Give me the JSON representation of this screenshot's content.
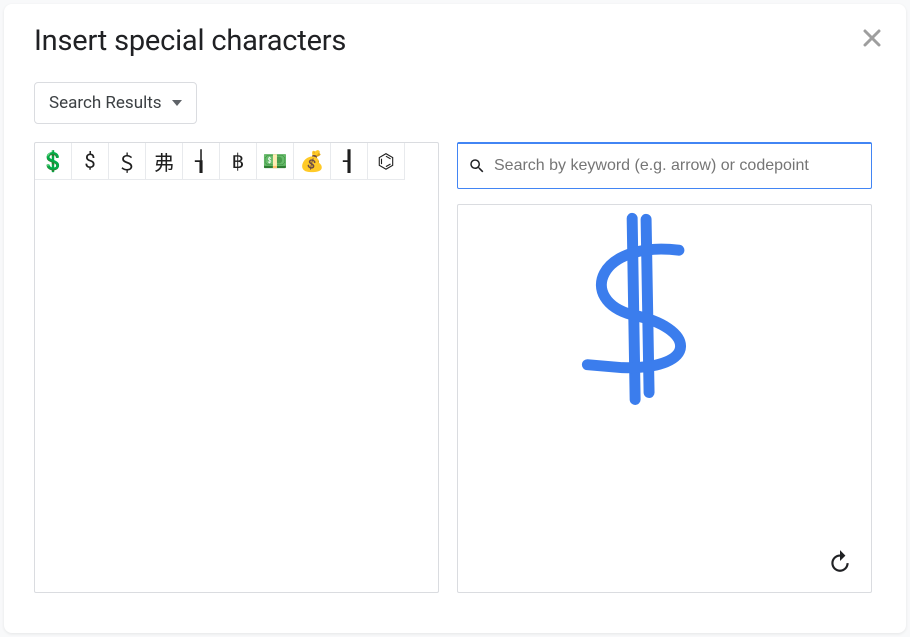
{
  "dialog": {
    "title": "Insert special characters",
    "close_label": "Close"
  },
  "category": {
    "selected": "Search Results"
  },
  "search": {
    "placeholder": "Search by keyword (e.g. arrow) or codepoint",
    "value": ""
  },
  "results": [
    {
      "char": "💲",
      "name": "heavy-dollar-sign"
    },
    {
      "char": "$",
      "name": "dollar-sign"
    },
    {
      "char": "＄",
      "name": "fullwidth-dollar-sign"
    },
    {
      "char": "弗",
      "name": "cjk-dollar"
    },
    {
      "char": "┧",
      "name": "box-drawing"
    },
    {
      "char": "฿",
      "name": "baht-sign"
    },
    {
      "char": "💵",
      "name": "dollar-banknote"
    },
    {
      "char": "💰",
      "name": "money-bag"
    },
    {
      "char": "┨",
      "name": "box-drawing-2"
    },
    {
      "char": "⌬",
      "name": "benzene-ring"
    }
  ],
  "canvas": {
    "undo_label": "Undo"
  }
}
